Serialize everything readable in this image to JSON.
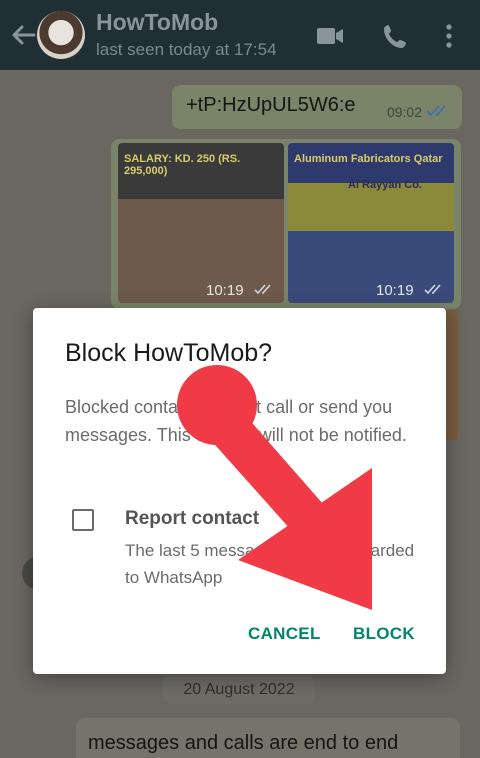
{
  "header": {
    "contact_name": "HowToMob",
    "status": "last seen today at 17:54",
    "icons": [
      "back-arrow-icon",
      "video-call-icon",
      "phone-icon",
      "more-vert-icon"
    ]
  },
  "messages": {
    "outgoing_text": "+tP:HzUpUL5W6:e",
    "outgoing_time": "09:02",
    "image1": {
      "title": "SALARY: KD. 250 (RS. 295,000)",
      "time": "10:19"
    },
    "image2": {
      "title": "Aluminum Fabricators Qatar",
      "subtitle": "Al Rayyan Co.",
      "time": "10:19"
    },
    "date_chip": "20 August 2022",
    "system_text": "messages and calls are end to end"
  },
  "dialog": {
    "title": "Block HowToMob?",
    "body": "Blocked contacts will not call or send you messages. This contact will not be notified.",
    "checkbox_label": "Report contact",
    "checkbox_checked": false,
    "checkbox_sub": "The last 5 messages will be forwarded to WhatsApp",
    "cancel_label": "CANCEL",
    "block_label": "BLOCK"
  },
  "colors": {
    "accent": "#00876a",
    "arrow": "#f03a45",
    "header": "#1f2f33"
  }
}
